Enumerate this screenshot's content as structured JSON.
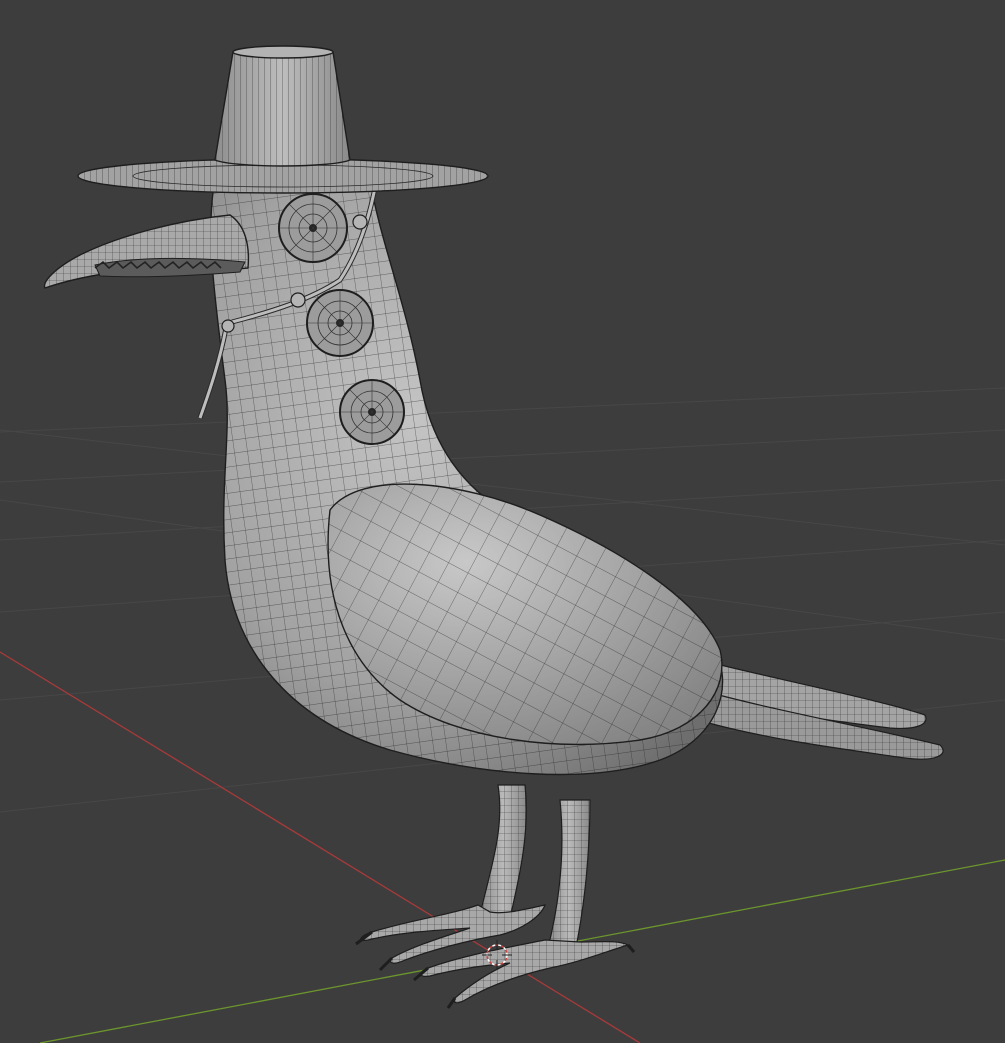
{
  "viewport": {
    "background": "#3d3d3d",
    "grid_color": "#454545",
    "x_axis_color": "#b03a3a",
    "y_axis_color": "#6f9a2e",
    "mesh_fill": "#9a9a9a",
    "mesh_highlight": "#bdbdbd",
    "wire_color": "#1e1e1e"
  },
  "object": {
    "name": "plague-doctor-bird",
    "parts": [
      "hat",
      "beak",
      "head",
      "body",
      "wing",
      "tail",
      "buttons",
      "chain",
      "legs",
      "feet"
    ]
  },
  "cursor_3d": {
    "icon": "3d-cursor-icon"
  }
}
